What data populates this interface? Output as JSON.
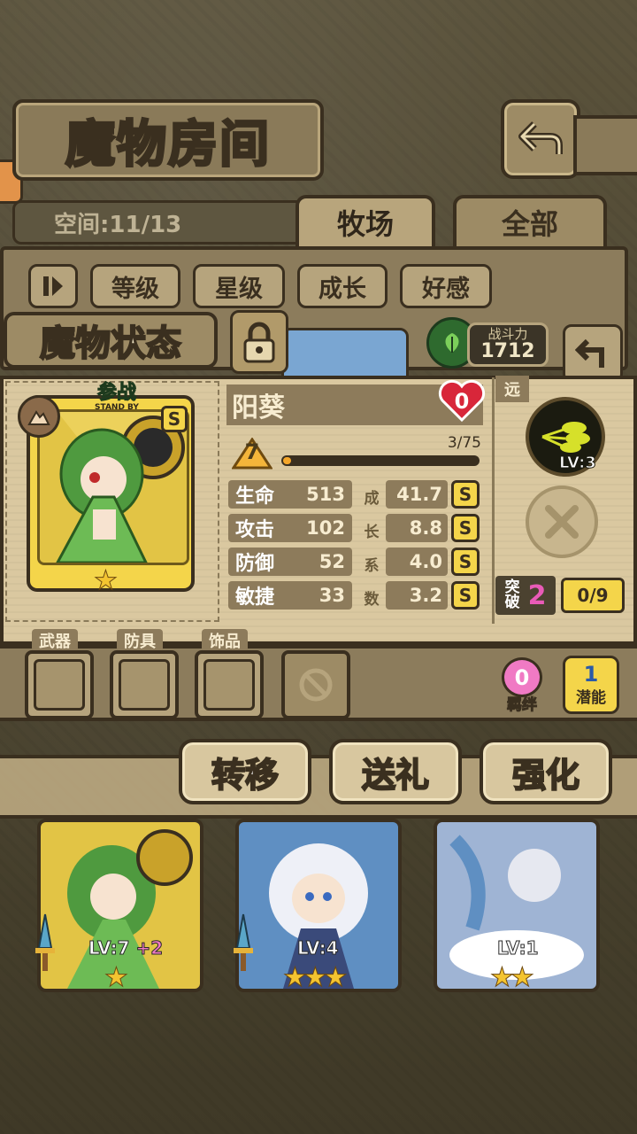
{
  "header": {
    "title": "魔物房间"
  },
  "space": {
    "label": "空间:11/13"
  },
  "tabs": [
    {
      "label": "牧场"
    },
    {
      "label": "全部"
    }
  ],
  "filters": [
    {
      "label": "等级"
    },
    {
      "label": "星级"
    },
    {
      "label": "成长"
    },
    {
      "label": "好感"
    }
  ],
  "status": {
    "title": "魔物状态",
    "power_label": "战斗力",
    "power_value": "1712"
  },
  "monster": {
    "name": "阳葵",
    "affection": "0",
    "level": "7",
    "exp": "3/75",
    "exp_progress": 0.04,
    "standby_label": "参战",
    "standby_sub": "STAND BY",
    "rank": "S",
    "stars": 1,
    "stats": [
      {
        "label": "生命",
        "value": "513",
        "growth": "41.7",
        "grade": "S"
      },
      {
        "label": "攻击",
        "value": "102",
        "growth": "8.8",
        "grade": "S"
      },
      {
        "label": "防御",
        "value": "52",
        "growth": "4.0",
        "grade": "S"
      },
      {
        "label": "敏捷",
        "value": "33",
        "growth": "3.2",
        "grade": "S"
      }
    ],
    "growth_vertical": [
      "成",
      "长",
      "系",
      "数"
    ],
    "range": "远",
    "skill_level": "LV:3",
    "break_label": "突破",
    "break_value": "2",
    "break_progress": "0/9"
  },
  "equipment": [
    {
      "label": "武器"
    },
    {
      "label": "防具"
    },
    {
      "label": "饰品"
    }
  ],
  "bond": {
    "value": "0",
    "label": "羁绊"
  },
  "potential": {
    "value": "1",
    "label": "潜能"
  },
  "actions": [
    {
      "label": "转移"
    },
    {
      "label": "送礼"
    },
    {
      "label": "强化"
    }
  ],
  "list": [
    {
      "level": "LV:7",
      "bonus": "+2",
      "stars": 1
    },
    {
      "level": "LV:4",
      "bonus": "",
      "stars": 3
    },
    {
      "level": "LV:1",
      "bonus": "",
      "stars": 2
    }
  ],
  "colors": {
    "gold": "#f4d54a",
    "dark": "#3a2f1f",
    "parchment": "#dac8a0",
    "pink": "#f07ac4",
    "heart": "#d8263a"
  }
}
